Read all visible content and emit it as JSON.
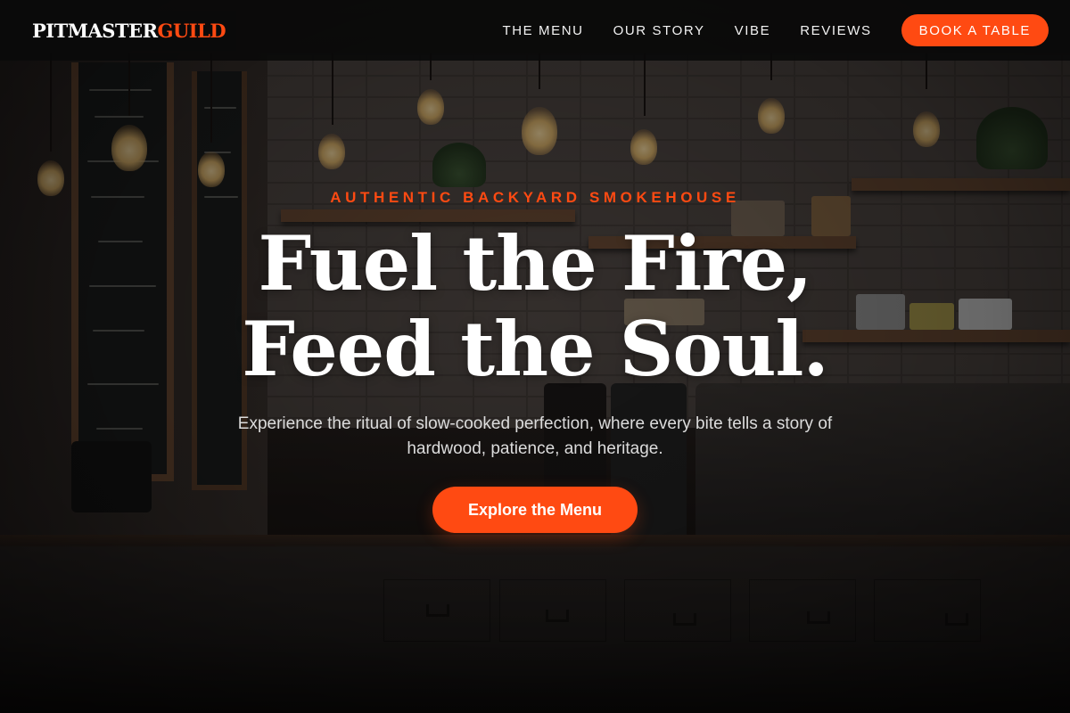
{
  "nav": {
    "logo_primary": "PITMASTER",
    "logo_accent": "GUILD",
    "links": [
      "THE MENU",
      "OUR STORY",
      "VIBE",
      "REVIEWS"
    ],
    "cta_label": "BOOK A TABLE"
  },
  "hero": {
    "eyebrow": "AUTHENTIC BACKYARD SMOKEHOUSE",
    "headline_line1": "Fuel the Fire,",
    "headline_line2": "Feed the Soul.",
    "subtitle": "Experience the ritual of slow-cooked perfection, where every bite tells a story of hardwood, patience, and heritage.",
    "cta_label": "Explore the Menu"
  },
  "colors": {
    "accent": "#ff4a12",
    "nav_background": "#0a0a0a",
    "text_primary": "#ffffff",
    "text_secondary": "#dcdcdc"
  }
}
